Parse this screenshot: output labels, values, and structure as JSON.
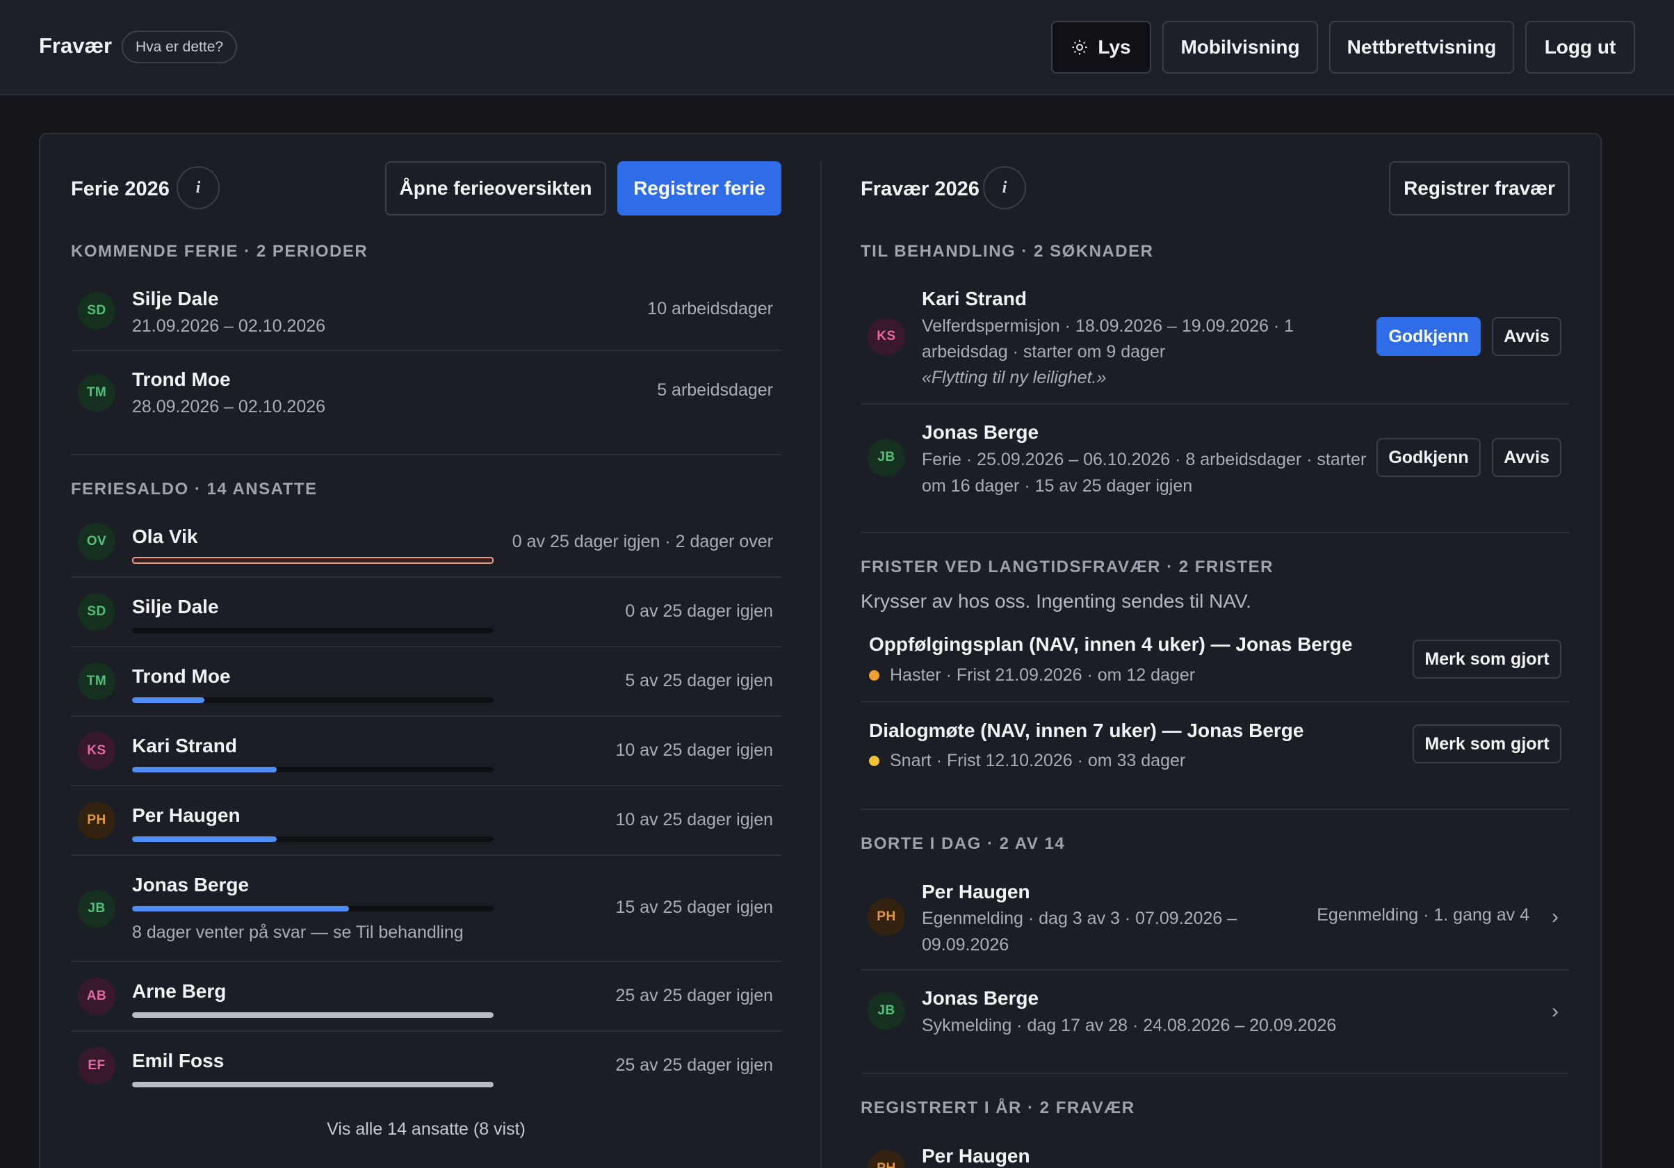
{
  "header": {
    "app_title": "Fravær",
    "help_label": "Hva er dette?",
    "buttons": {
      "theme": "Lys",
      "mobile": "Mobilvisning",
      "tablet": "Nettbrettvisning",
      "logout": "Logg ut"
    }
  },
  "vacation": {
    "title": "Ferie 2026",
    "info_icon": "i",
    "open_overview": "Åpne ferieoversikten",
    "register": "Registrer ferie",
    "upcoming_label": "KOMMENDE FERIE · 2 PERIODER",
    "upcoming": [
      {
        "initials": "SD",
        "name": "Silje Dale",
        "dates": "21.09.2026 – 02.10.2026",
        "days": "10 arbeidsdager"
      },
      {
        "initials": "TM",
        "name": "Trond Moe",
        "dates": "28.09.2026 – 02.10.2026",
        "days": "5 arbeidsdager"
      }
    ],
    "balance_label": "FERIESALDO · 14 ANSATTE",
    "balances": [
      {
        "initials": "OV",
        "name": "Ola Vik",
        "text": "0 av 25 dager igjen · 2 dager over",
        "fraction": 0,
        "over": true
      },
      {
        "initials": "SD",
        "name": "Silje Dale",
        "text": "0 av 25 dager igjen",
        "fraction": 0
      },
      {
        "initials": "TM",
        "name": "Trond Moe",
        "text": "5 av 25 dager igjen",
        "fraction": 0.2
      },
      {
        "initials": "KS",
        "name": "Kari Strand",
        "text": "10 av 25 dager igjen",
        "fraction": 0.4
      },
      {
        "initials": "PH",
        "name": "Per Haugen",
        "text": "10 av 25 dager igjen",
        "fraction": 0.4
      },
      {
        "initials": "JB",
        "name": "Jonas Berge",
        "text": "15 av 25 dager igjen",
        "fraction": 0.6,
        "note": "8 dager venter på svar — se Til behandling"
      },
      {
        "initials": "AB",
        "name": "Arne Berg",
        "text": "25 av 25 dager igjen",
        "fraction": 1
      },
      {
        "initials": "EF",
        "name": "Emil Foss",
        "text": "25 av 25 dager igjen",
        "fraction": 1
      }
    ],
    "show_all": "Vis alle 14 ansatte (8 vist)"
  },
  "absence": {
    "title": "Fravær 2026",
    "info_icon": "i",
    "register": "Registrer fravær",
    "pending_label": "TIL BEHANDLING · 2 SØKNADER",
    "pending": [
      {
        "initials": "KS",
        "name": "Kari Strand",
        "line1": "Velferdspermisjon · 18.09.2026 – 19.09.2026 · 1",
        "line2": "arbeidsdag · starter om 9 dager",
        "comment": "«Flytting til ny leilighet.»",
        "approve": "Godkjenn",
        "reject": "Avvis"
      },
      {
        "initials": "JB",
        "name": "Jonas Berge",
        "line1": "Ferie · 25.09.2026 – 06.10.2026 · 8 arbeidsdager · starter",
        "line2": "om 16 dager · 15 av 25 dager igjen",
        "approve": "Godkjenn",
        "reject": "Avvis"
      }
    ],
    "deadlines_label": "FRISTER VED LANGTIDSFRAVÆR · 2 FRISTER",
    "deadlines_note": "Krysser av hos oss. Ingenting sendes til NAV.",
    "deadlines": [
      {
        "title": "Oppfølgingsplan (NAV, innen 4 uker) — Jonas Berge",
        "status": "Haster · Frist 21.09.2026 · om 12 dager",
        "color": "#f0a030",
        "action": "Merk som gjort"
      },
      {
        "title": "Dialogmøte (NAV, innen 7 uker) — Jonas Berge",
        "status": "Snart · Frist 12.10.2026 · om 33 dager",
        "color": "#f2c233",
        "action": "Merk som gjort"
      }
    ],
    "away_label": "BORTE I DAG · 2 AV 14",
    "away": [
      {
        "initials": "PH",
        "name": "Per Haugen",
        "line1": "Egenmelding · dag 3 av 3 · 07.09.2026 –",
        "line2": "09.09.2026",
        "right": "Egenmelding · 1. gang av 4"
      },
      {
        "initials": "JB",
        "name": "Jonas Berge",
        "line1": "Sykmelding · dag 17 av 28 · 24.08.2026 – 20.09.2026"
      }
    ],
    "registered_label": "REGISTRERT I ÅR · 2 FRAVÆR",
    "registered": [
      {
        "initials": "PH",
        "name": "Per Haugen"
      }
    ]
  },
  "colors": {
    "accent": "#2f6de8",
    "bar_blue": "#4f8ef7",
    "bar_full": "#b9bcc4",
    "over_red": "#e89a8a"
  }
}
